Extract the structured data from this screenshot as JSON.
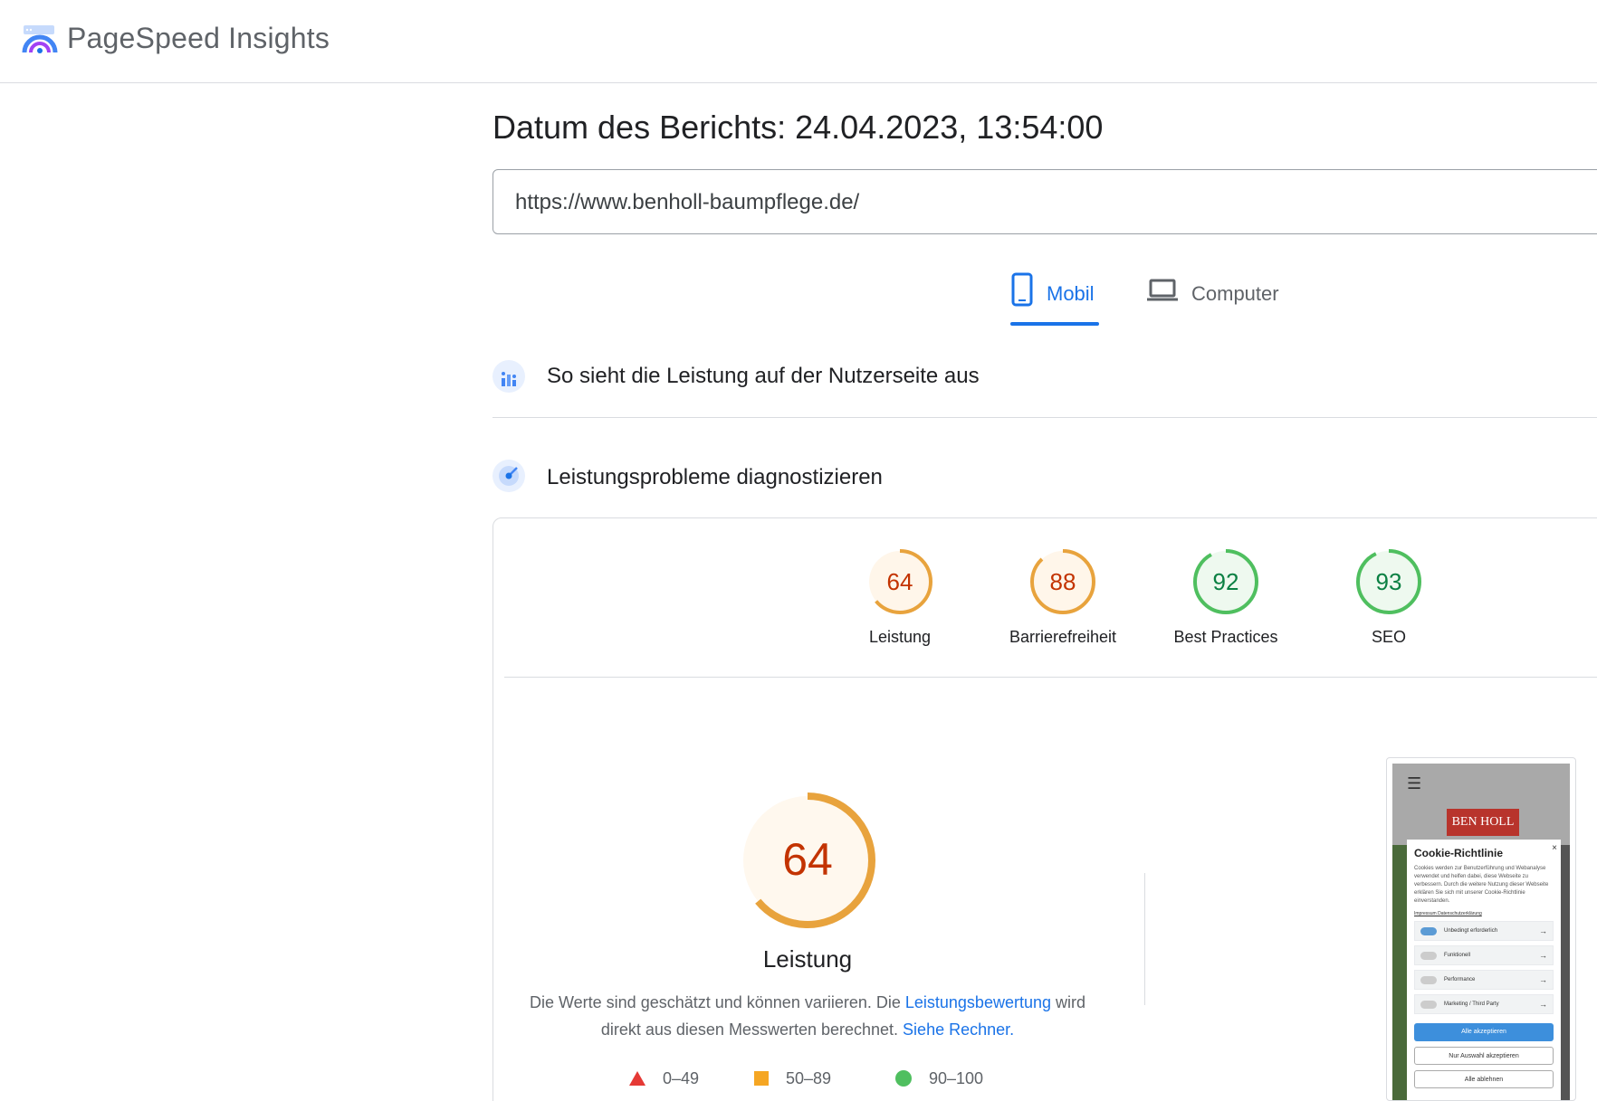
{
  "header": {
    "brand": "PageSpeed Insights"
  },
  "report": {
    "date_label": "Datum des Berichts: 24.04.2023, 13:54:00"
  },
  "url_field": {
    "value": "https://www.benholl-baumpflege.de/"
  },
  "device_tabs": [
    {
      "label": "Mobil",
      "selected": true,
      "icon": "phone-icon"
    },
    {
      "label": "Computer",
      "selected": false,
      "icon": "laptop-icon"
    }
  ],
  "sections": {
    "field_data": {
      "title": "So sieht die Leistung auf der Nutzerseite aus",
      "icon": "users-chart-icon"
    },
    "diagnose": {
      "title": "Leistungsprobleme diagnostizieren",
      "icon": "lighthouse-icon"
    }
  },
  "scores": [
    {
      "value": 64,
      "label": "Leistung",
      "color": "#e8a33d"
    },
    {
      "value": 88,
      "label": "Barrierefreiheit",
      "color": "#e8a33d"
    },
    {
      "value": 92,
      "label": "Best Practices",
      "color": "#4fbf5f"
    },
    {
      "value": 93,
      "label": "SEO",
      "color": "#4fbf5f"
    }
  ],
  "performance": {
    "score": 64,
    "label": "Leistung",
    "desc_part1": "Die Werte sind geschätzt und können variieren. Die ",
    "desc_link1": "Leistungsbewertung",
    "desc_part2": " wird direkt aus diesen Messwerten berechnet. ",
    "desc_link2": "Siehe Rechner."
  },
  "legend": [
    {
      "range": "0–49",
      "shape": "triangle",
      "color": "#e53935"
    },
    {
      "range": "50–89",
      "shape": "square",
      "color": "#f5a623"
    },
    {
      "range": "90–100",
      "shape": "circle",
      "color": "#4fbf5f"
    }
  ],
  "screenshot": {
    "logo_text": "BEN HOLL",
    "cookie_title": "Cookie-Richtlinie",
    "cookie_text": "Cookies werden zur Benutzerführung und Webanalyse verwendet und helfen dabei, diese Webseite zu verbessern. Durch die weitere Nutzung dieser Webseite erklären Sie sich mit unserer Cookie-Richtlinie einverstanden.",
    "cookie_links": "Impressum   Datenschutzerklärung",
    "rows": [
      "Unbedingt erforderlich",
      "Funktionell",
      "Performance",
      "Marketing / Third Party"
    ],
    "btn_all": "Alle akzeptieren",
    "btn_selection": "Nur Auswahl akzeptieren",
    "btn_reject": "Alle ablehnen"
  }
}
